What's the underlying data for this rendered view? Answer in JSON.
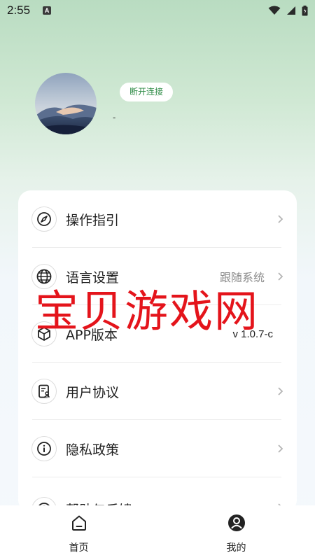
{
  "status_bar": {
    "time": "2:55",
    "notification_icon_letter": "A",
    "icons": [
      "wifi-icon",
      "signal-icon",
      "battery-icon"
    ]
  },
  "profile": {
    "avatar_icon": "desert-landscape-avatar",
    "disconnect_label": "断开连接",
    "username": "-"
  },
  "menu": {
    "items": [
      {
        "label": "操作指引",
        "value": "",
        "icon": "compass-icon",
        "has_chevron": true
      },
      {
        "label": "语言设置",
        "value": "跟随系统",
        "icon": "globe-icon",
        "has_chevron": true
      },
      {
        "label": "APP版本",
        "value": "v 1.0.7-c",
        "icon": "cube-icon",
        "has_chevron": false
      },
      {
        "label": "用户协议",
        "value": "",
        "icon": "document-user-icon",
        "has_chevron": true
      },
      {
        "label": "隐私政策",
        "value": "",
        "icon": "info-icon",
        "has_chevron": true
      },
      {
        "label": "帮助与反馈",
        "value": "",
        "icon": "help-icon",
        "has_chevron": true
      }
    ]
  },
  "watermark": "宝贝游戏网",
  "tabbar": {
    "tabs": [
      {
        "label": "首页",
        "icon": "home-icon"
      },
      {
        "label": "我的",
        "icon": "user-icon"
      }
    ]
  },
  "colors": {
    "accent_green": "#2c8a44",
    "watermark_red": "#e4141b"
  }
}
